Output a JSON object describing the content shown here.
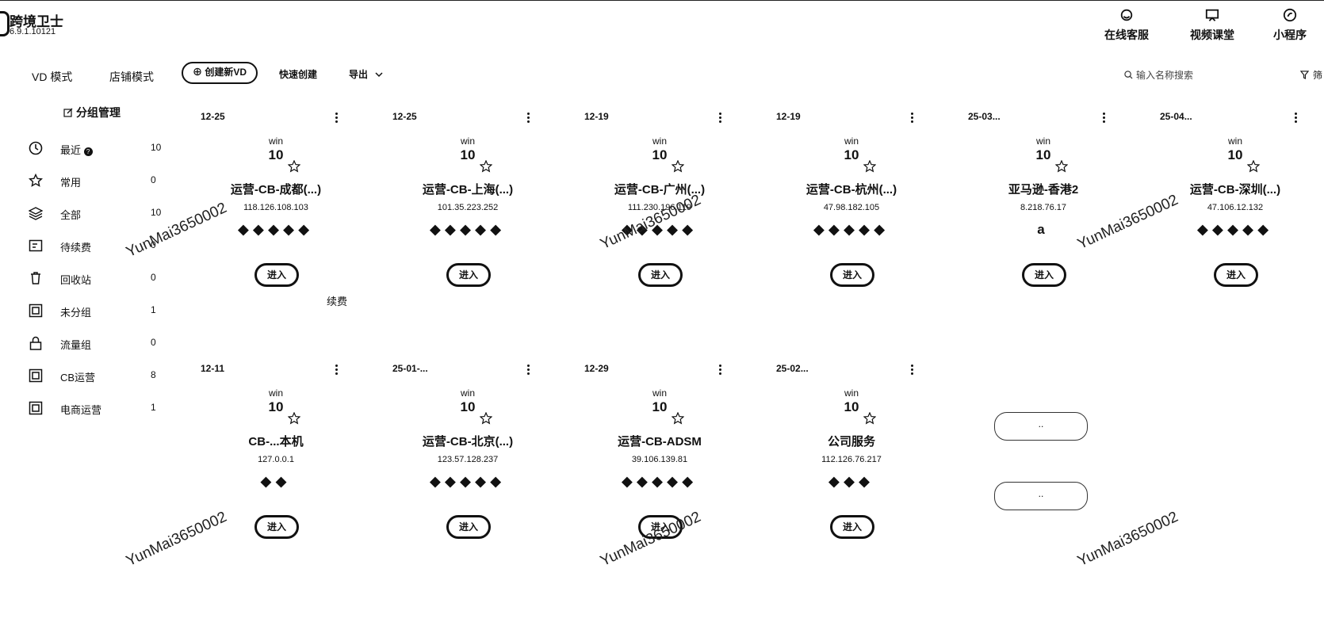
{
  "app": {
    "name": "跨境卫士",
    "version": "6.9.1.10121"
  },
  "top_actions": [
    {
      "label": "在线客服",
      "icon": "support-agent-icon"
    },
    {
      "label": "视频课堂",
      "icon": "video-class-icon"
    },
    {
      "label": "小程序",
      "icon": "mini-program-icon"
    }
  ],
  "toolbar": {
    "vd_mode": "VD 模式",
    "shop_mode": "店铺模式",
    "create_new": "⊕ 创建新VD",
    "quick_create": "快速创建",
    "export": "导出",
    "search_placeholder": "输入名称搜索",
    "filter": "筛"
  },
  "sidebar": {
    "group_manage": "分组管理",
    "items": [
      {
        "label": "最近",
        "count": "10",
        "icon": "clock-icon"
      },
      {
        "label": "常用",
        "count": "0",
        "icon": "star-icon"
      },
      {
        "label": "全部",
        "count": "10",
        "icon": "layers-icon"
      },
      {
        "label": "待续费",
        "count": "0",
        "icon": "renew-icon"
      },
      {
        "label": "回收站",
        "count": "0",
        "icon": "trash-icon"
      },
      {
        "label": "未分组",
        "count": "1",
        "icon": "group-icon"
      },
      {
        "label": "流量组",
        "count": "0",
        "icon": "lock-icon"
      },
      {
        "label": "CB运营",
        "count": "8",
        "icon": "group-icon"
      },
      {
        "label": "电商运营",
        "count": "1",
        "icon": "group-icon"
      }
    ]
  },
  "cards": [
    {
      "date": "12-25",
      "os": "win",
      "version": "10",
      "name": "运营-CB-成都(...)",
      "ip": "118.126.108.103",
      "tags": "◆◆◆◆◆",
      "enter": "进入"
    },
    {
      "date": "12-25",
      "os": "win",
      "version": "10",
      "name": "运营-CB-上海(...)",
      "ip": "101.35.223.252",
      "tags": "◆◆◆◆◆",
      "enter": "进入"
    },
    {
      "date": "12-19",
      "os": "win",
      "version": "10",
      "name": "运营-CB-广州(...)",
      "ip": "111.230.196.119",
      "tags": "◆◆◆◆◆",
      "enter": "进入"
    },
    {
      "date": "12-19",
      "os": "win",
      "version": "10",
      "name": "运营-CB-杭州(...)",
      "ip": "47.98.182.105",
      "tags": "◆◆◆◆◆",
      "enter": "进入"
    },
    {
      "date": "25-03...",
      "os": "win",
      "version": "10",
      "name": "亚马逊-香港2",
      "ip": "8.218.76.17",
      "tags": "a",
      "enter": "进入"
    },
    {
      "date": "25-04...",
      "os": "win",
      "version": "10",
      "name": "运营-CB-深圳(...)",
      "ip": "47.106.12.132",
      "tags": "◆◆◆◆◆",
      "enter": "进入"
    },
    {
      "date": "12-11",
      "os": "win",
      "version": "10",
      "name": "CB-...本机",
      "ip": "127.0.0.1",
      "tags": "◆◆",
      "enter": "进入"
    },
    {
      "date": "25-01-...",
      "os": "win",
      "version": "10",
      "name": "运营-CB-北京(...)",
      "ip": "123.57.128.237",
      "tags": "◆◆◆◆◆",
      "enter": "进入"
    },
    {
      "date": "12-29",
      "os": "win",
      "version": "10",
      "name": "运营-CB-ADSM",
      "ip": "39.106.139.81",
      "tags": "◆◆◆◆◆",
      "enter": "进入"
    },
    {
      "date": "25-02...",
      "os": "win",
      "version": "10",
      "name": "公司服务",
      "ip": "112.126.76.217",
      "tags": "◆◆◆",
      "enter": "进入"
    }
  ],
  "renew_label": "续费",
  "ghost_buttons": [
    "..",
    ".."
  ],
  "watermark": "YunMai3650002"
}
